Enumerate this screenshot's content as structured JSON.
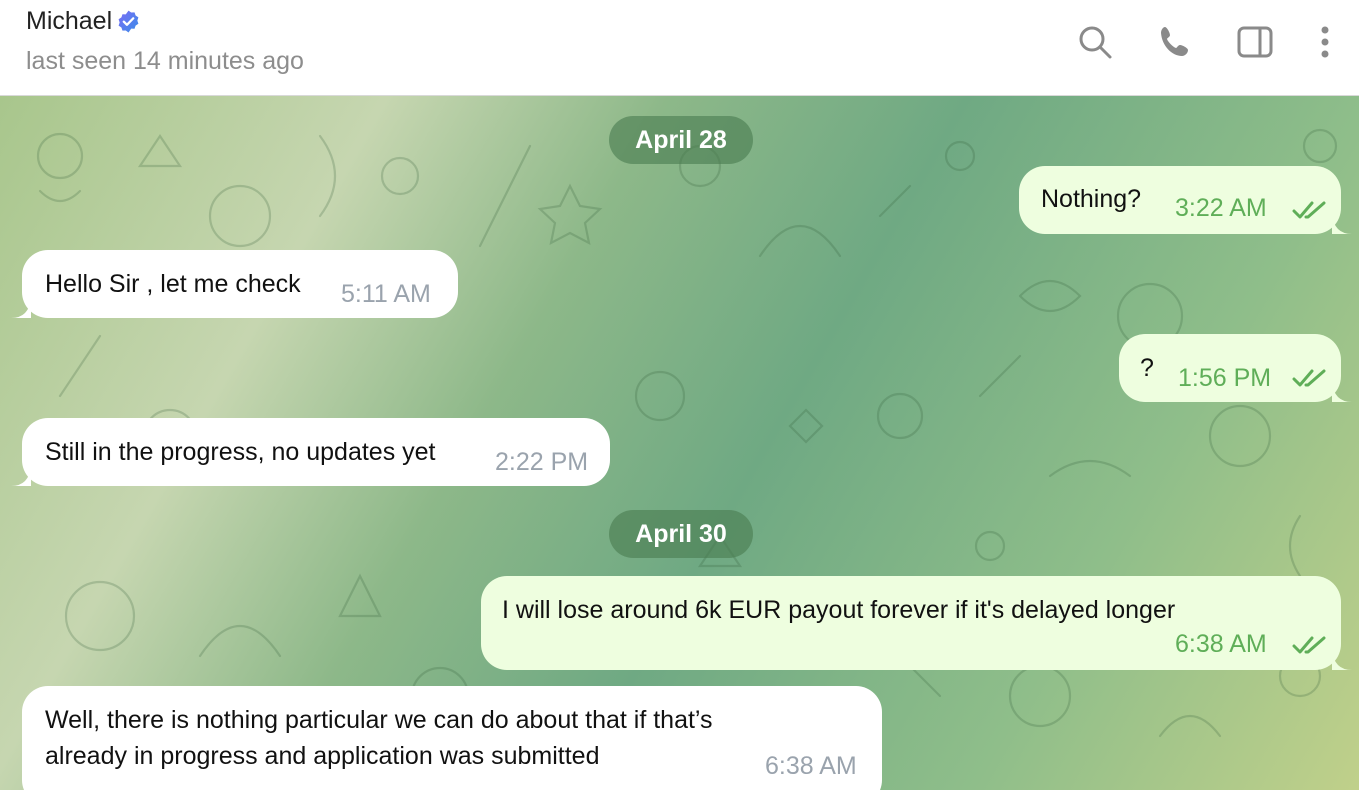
{
  "header": {
    "contact_name": "Michael",
    "status": "last seen 14 minutes ago",
    "icons": [
      "verified-badge-icon",
      "search-icon",
      "phone-icon",
      "sidebar-toggle-icon",
      "more-vertical-icon"
    ]
  },
  "colors": {
    "incoming_bubble": "#ffffff",
    "outgoing_bubble": "#eefedf",
    "outgoing_time": "#5fae58",
    "incoming_time": "#9aa3ad",
    "date_pill": "#4b7d50"
  },
  "dates": [
    "April 28",
    "April 30"
  ],
  "messages": [
    {
      "direction": "out",
      "text": "Nothing?",
      "time": "3:22 AM",
      "status": "read"
    },
    {
      "direction": "in",
      "text": "Hello Sir , let me check",
      "time": "5:11 AM"
    },
    {
      "direction": "out",
      "text": "?",
      "time": "1:56 PM",
      "status": "read"
    },
    {
      "direction": "in",
      "text": "Still in the progress, no updates yet",
      "time": "2:22 PM"
    },
    {
      "direction": "out",
      "text": "I will lose around 6k EUR payout forever if it's delayed longer",
      "time": "6:38 AM",
      "status": "read"
    },
    {
      "direction": "in",
      "lines": [
        "Well, there is nothing particular we can do about that if that’s",
        "already in progress and application was submitted"
      ],
      "time": "6:38 AM"
    }
  ]
}
